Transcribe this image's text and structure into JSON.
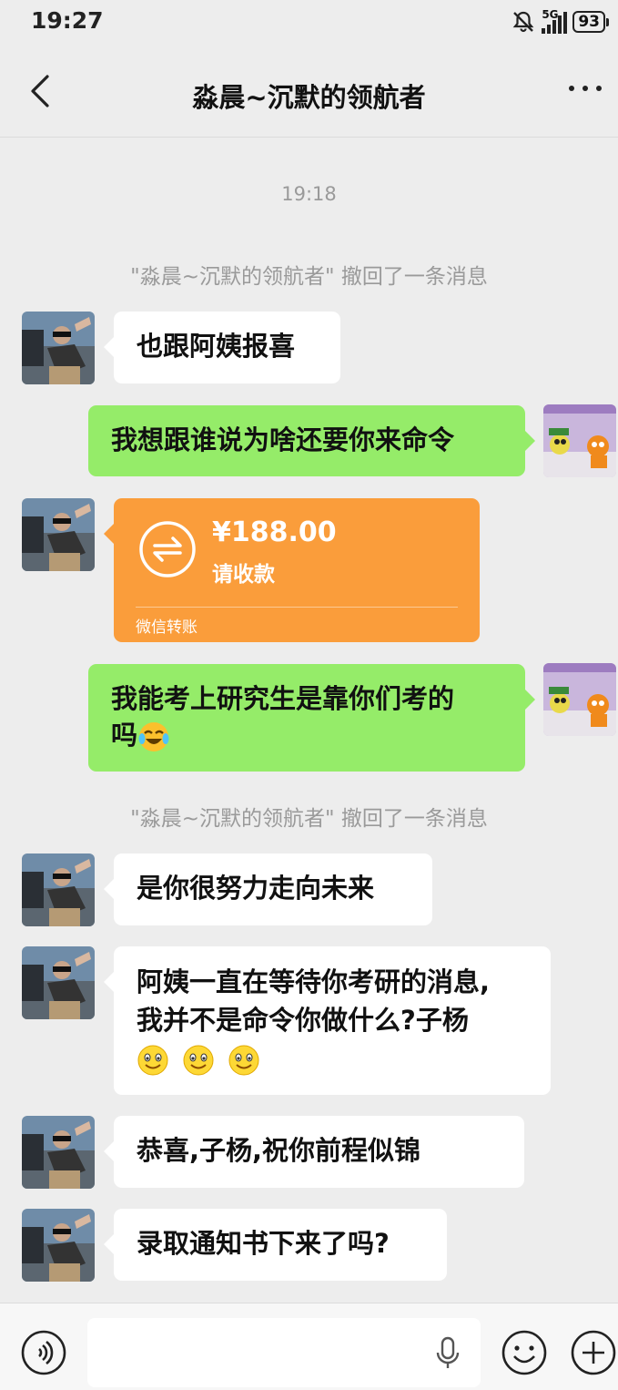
{
  "status_bar": {
    "time": "19:27",
    "network": "5G",
    "battery": "93"
  },
  "header": {
    "title": "淼晨~沉默的领航者"
  },
  "chat": {
    "timestamp": "19:18",
    "recall_notice_1": "\"淼晨~沉默的领航者\" 撤回了一条消息",
    "recall_notice_2": "\"淼晨~沉默的领航者\" 撤回了一条消息",
    "messages": [
      {
        "side": "left",
        "text": "也跟阿姨报喜"
      },
      {
        "side": "right",
        "text": "我想跟谁说为啥还要你来命令"
      },
      {
        "side": "left",
        "type": "transfer",
        "amount": "¥188.00",
        "label": "请收款",
        "source": "微信转账"
      },
      {
        "side": "right",
        "line1": "我能考上研究生是靠你们考的",
        "line2": "吗",
        "emoji": "crying-laughing-emoji"
      },
      {
        "side": "left",
        "text": "是你很努力走向未来"
      },
      {
        "side": "left",
        "line1": "阿姨一直在等待你考研的消息,",
        "line2": "我并不是命令你做什么?子杨",
        "emoji": "smile-emoji"
      },
      {
        "side": "left",
        "text": "恭喜,子杨,祝你前程似锦"
      },
      {
        "side": "left",
        "text": "录取通知书下来了吗?"
      }
    ]
  },
  "colors": {
    "outgoing_bubble": "#95ec69",
    "transfer_card": "#fa9d3b",
    "background": "#ededed"
  }
}
